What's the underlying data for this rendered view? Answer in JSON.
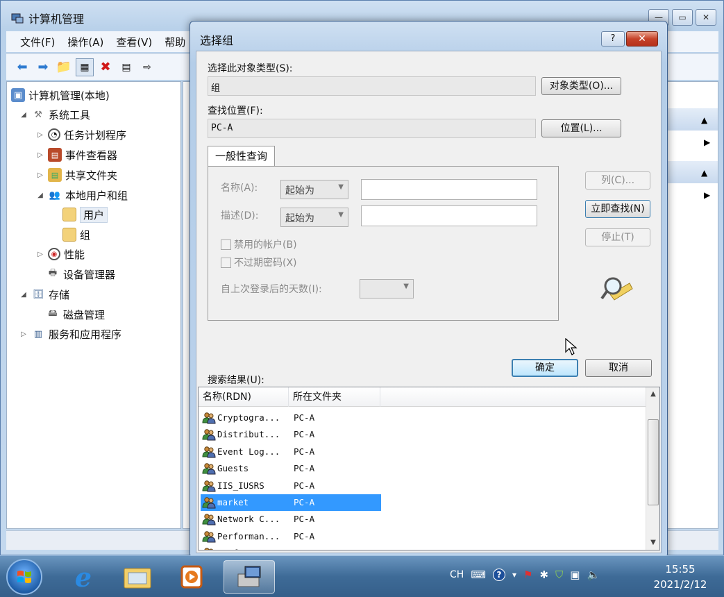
{
  "main_window": {
    "title": "计算机管理",
    "menu": [
      "文件(F)",
      "操作(A)",
      "查看(V)",
      "帮助"
    ],
    "tree": [
      {
        "label": "计算机管理(本地)",
        "icon": "computer-mgmt-icon",
        "level": 0,
        "expander": ""
      },
      {
        "label": "系统工具",
        "icon": "tools-icon",
        "level": 1,
        "expander": "expanded"
      },
      {
        "label": "任务计划程序",
        "icon": "clock-icon",
        "level": 2,
        "expander": "collapsed"
      },
      {
        "label": "事件查看器",
        "icon": "event-viewer-icon",
        "level": 2,
        "expander": "collapsed"
      },
      {
        "label": "共享文件夹",
        "icon": "shared-folder-icon",
        "level": 2,
        "expander": "collapsed"
      },
      {
        "label": "本地用户和组",
        "icon": "users-icon",
        "level": 2,
        "expander": "expanded"
      },
      {
        "label": "用户",
        "icon": "folder-icon",
        "level": 3,
        "expander": "",
        "selected": true
      },
      {
        "label": "组",
        "icon": "folder-icon",
        "level": 3,
        "expander": ""
      },
      {
        "label": "性能",
        "icon": "performance-icon",
        "level": 2,
        "expander": "collapsed"
      },
      {
        "label": "设备管理器",
        "icon": "device-manager-icon",
        "level": 2,
        "expander": ""
      },
      {
        "label": "存储",
        "icon": "storage-icon",
        "level": 1,
        "expander": "expanded"
      },
      {
        "label": "磁盘管理",
        "icon": "disk-icon",
        "level": 2,
        "expander": ""
      },
      {
        "label": "服务和应用程序",
        "icon": "services-icon",
        "level": 1,
        "expander": "collapsed"
      }
    ]
  },
  "dialog": {
    "title": "选择组",
    "help_label": "?",
    "object_type_label": "选择此对象类型(S):",
    "object_type_value": "组",
    "object_type_button": "对象类型(O)...",
    "location_label": "查找位置(F):",
    "location_value": "PC-A",
    "location_button": "位置(L)...",
    "tab_label": "一般性查询",
    "name_label": "名称(A):",
    "name_combo": "起始为",
    "desc_label": "描述(D):",
    "desc_combo": "起始为",
    "disabled_accounts_label": "禁用的帐户(B)",
    "non_expiring_label": "不过期密码(X)",
    "days_since_login_label": "自上次登录后的天数(I):",
    "columns_button": "列(C)...",
    "find_now_button": "立即查找(N)",
    "stop_button": "停止(T)",
    "ok_button": "确定",
    "cancel_button": "取消",
    "results_label": "搜索结果(U):",
    "columns": [
      "名称(RDN)",
      "所在文件夹"
    ],
    "results": [
      {
        "name": "Cryptogra...",
        "folder": "PC-A"
      },
      {
        "name": "Distribut...",
        "folder": "PC-A"
      },
      {
        "name": "Event Log...",
        "folder": "PC-A"
      },
      {
        "name": "Guests",
        "folder": "PC-A"
      },
      {
        "name": "IIS_IUSRS",
        "folder": "PC-A"
      },
      {
        "name": "market",
        "folder": "PC-A",
        "selected": true
      },
      {
        "name": "Network C...",
        "folder": "PC-A"
      },
      {
        "name": "Performan...",
        "folder": "PC-A"
      },
      {
        "name": "Performan...",
        "folder": "PC-A"
      }
    ]
  },
  "taskbar": {
    "tray_lang": "CH",
    "time": "15:55",
    "date": "2021/2/12"
  }
}
